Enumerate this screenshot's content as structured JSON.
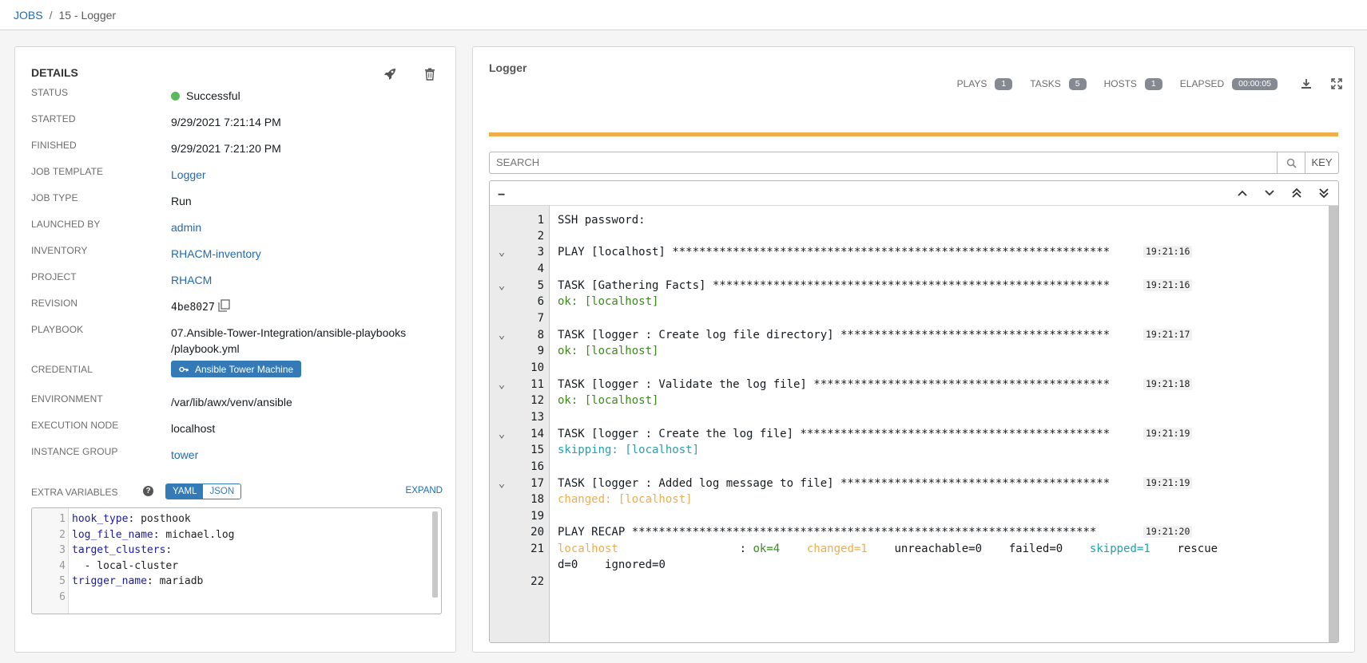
{
  "breadcrumb": {
    "jobs": "JOBS",
    "separator": "/",
    "current": "15 - Logger"
  },
  "details": {
    "title": "DETAILS",
    "rows": {
      "status": {
        "label": "STATUS",
        "value": "Successful",
        "color": "#5cb85c"
      },
      "started": {
        "label": "STARTED",
        "value": "9/29/2021 7:21:14 PM"
      },
      "finished": {
        "label": "FINISHED",
        "value": "9/29/2021 7:21:20 PM"
      },
      "job_template": {
        "label": "JOB TEMPLATE",
        "value": "Logger"
      },
      "job_type": {
        "label": "JOB TYPE",
        "value": "Run"
      },
      "launched_by": {
        "label": "LAUNCHED BY",
        "value": "admin"
      },
      "inventory": {
        "label": "INVENTORY",
        "value": "RHACM-inventory"
      },
      "project": {
        "label": "PROJECT",
        "value": "RHACM"
      },
      "revision": {
        "label": "REVISION",
        "value": "4be8027"
      },
      "playbook": {
        "label": "PLAYBOOK",
        "value_line1": "07.Ansible-Tower-Integration/ansible-playbooks",
        "value_line2": "/playbook.yml"
      },
      "credential": {
        "label": "CREDENTIAL",
        "value": "Ansible Tower Machine"
      },
      "environment": {
        "label": "ENVIRONMENT",
        "value": "/var/lib/awx/venv/ansible"
      },
      "execution_node": {
        "label": "EXECUTION NODE",
        "value": "localhost"
      },
      "instance_group": {
        "label": "INSTANCE GROUP",
        "value": "tower"
      }
    },
    "extra_variables": {
      "label": "EXTRA VARIABLES",
      "help": "?",
      "yaml": "YAML",
      "json": "JSON",
      "expand": "EXPAND",
      "lines": [
        {
          "n": "1",
          "key": "hook_type",
          "rest": ": posthook"
        },
        {
          "n": "2",
          "key": "log_file_name",
          "rest": ": michael.log"
        },
        {
          "n": "3",
          "key": "target_clusters",
          "rest": ":"
        },
        {
          "n": "4",
          "key": "",
          "rest": "  - local-cluster"
        },
        {
          "n": "5",
          "key": "trigger_name",
          "rest": ": mariadb"
        },
        {
          "n": "6",
          "key": "",
          "rest": ""
        }
      ]
    }
  },
  "output": {
    "title": "Logger",
    "stats": {
      "plays_label": "PLAYS",
      "plays": "1",
      "tasks_label": "TASKS",
      "tasks": "5",
      "hosts_label": "HOSTS",
      "hosts": "1",
      "elapsed_label": "ELAPSED",
      "elapsed": "00:00:05"
    },
    "progress_percent": 100,
    "progress_color": "#f0ad4e",
    "search_placeholder": "SEARCH",
    "key_label": "KEY",
    "collapse_symbol": "−",
    "log": [
      {
        "n": "1",
        "text": "SSH password:",
        "chev": "",
        "ts": "",
        "cls": ""
      },
      {
        "n": "2",
        "text": "",
        "chev": "",
        "ts": "",
        "cls": ""
      },
      {
        "n": "3",
        "text": "PLAY [localhost] *****************************************************************",
        "chev": "⌄",
        "ts": "19:21:16",
        "cls": ""
      },
      {
        "n": "4",
        "text": "",
        "chev": "",
        "ts": "",
        "cls": ""
      },
      {
        "n": "5",
        "text": "TASK [Gathering Facts] ***********************************************************",
        "chev": "⌄",
        "ts": "19:21:16",
        "cls": ""
      },
      {
        "n": "6",
        "text": "ok: [localhost]",
        "chev": "",
        "ts": "",
        "cls": "c-ok"
      },
      {
        "n": "7",
        "text": "",
        "chev": "",
        "ts": "",
        "cls": ""
      },
      {
        "n": "8",
        "text": "TASK [logger : Create log file directory] ****************************************",
        "chev": "⌄",
        "ts": "19:21:17",
        "cls": ""
      },
      {
        "n": "9",
        "text": "ok: [localhost]",
        "chev": "",
        "ts": "",
        "cls": "c-ok"
      },
      {
        "n": "10",
        "text": "",
        "chev": "",
        "ts": "",
        "cls": ""
      },
      {
        "n": "11",
        "text": "TASK [logger : Validate the log file] ********************************************",
        "chev": "⌄",
        "ts": "19:21:18",
        "cls": ""
      },
      {
        "n": "12",
        "text": "ok: [localhost]",
        "chev": "",
        "ts": "",
        "cls": "c-ok"
      },
      {
        "n": "13",
        "text": "",
        "chev": "",
        "ts": "",
        "cls": ""
      },
      {
        "n": "14",
        "text": "TASK [logger : Create the log file] **********************************************",
        "chev": "⌄",
        "ts": "19:21:19",
        "cls": ""
      },
      {
        "n": "15",
        "text": "skipping: [localhost]",
        "chev": "",
        "ts": "",
        "cls": "c-skip"
      },
      {
        "n": "16",
        "text": "",
        "chev": "",
        "ts": "",
        "cls": ""
      },
      {
        "n": "17",
        "text": "TASK [logger : Added log message to file] ****************************************",
        "chev": "⌄",
        "ts": "19:21:19",
        "cls": ""
      },
      {
        "n": "18",
        "text": "changed: [localhost]",
        "chev": "",
        "ts": "",
        "cls": "c-chg"
      },
      {
        "n": "19",
        "text": "",
        "chev": "",
        "ts": "",
        "cls": ""
      },
      {
        "n": "20",
        "text": "PLAY RECAP *********************************************************************",
        "chev": "",
        "ts": "19:21:20",
        "cls": ""
      }
    ],
    "recap": {
      "n": "21",
      "host": "localhost",
      "colon": "                  : ",
      "ok": "ok=4",
      "changed": "changed=1",
      "unreachable": "unreachable=0",
      "failed": "failed=0",
      "skipped": "skipped=1",
      "rescued_a": "rescue",
      "rescued_b": "d=0",
      "ignored": "ignored=0"
    },
    "last_line": "22"
  }
}
